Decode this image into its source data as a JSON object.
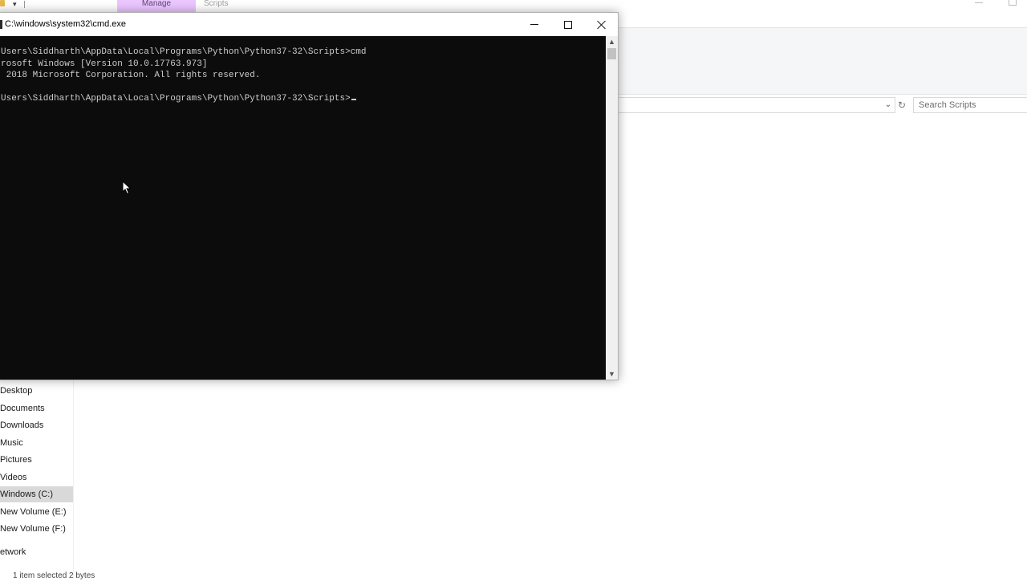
{
  "explorer": {
    "quick_access_dropdown": "▾",
    "manage_tab": "Manage",
    "window_title": "Scripts",
    "search_placeholder": "Search Scripts",
    "address_chevron": "⌄",
    "refresh_icon": "↻",
    "nav_items": [
      {
        "label": "Desktop",
        "icon": "desktop-icon",
        "selected": false
      },
      {
        "label": "Documents",
        "icon": "documents-icon",
        "selected": false
      },
      {
        "label": "Downloads",
        "icon": "downloads-icon",
        "selected": false
      },
      {
        "label": "Music",
        "icon": "music-icon",
        "selected": false
      },
      {
        "label": "Pictures",
        "icon": "pictures-icon",
        "selected": false
      },
      {
        "label": "Videos",
        "icon": "videos-icon",
        "selected": false
      },
      {
        "label": "Windows (C:)",
        "icon": "drive-icon",
        "selected": true
      },
      {
        "label": "New Volume (E:)",
        "icon": "drive-icon",
        "selected": false
      },
      {
        "label": "New Volume (F:)",
        "icon": "drive-icon",
        "selected": false
      },
      {
        "label": "etwork",
        "icon": "network-icon",
        "selected": false
      }
    ],
    "status": "1 item selected  2 bytes"
  },
  "cmd": {
    "title": "C:\\windows\\system32\\cmd.exe",
    "lines": [
      "Users\\Siddharth\\AppData\\Local\\Programs\\Python\\Python37-32\\Scripts>cmd",
      "rosoft Windows [Version 10.0.17763.973]",
      " 2018 Microsoft Corporation. All rights reserved.",
      "",
      "Users\\Siddharth\\AppData\\Local\\Programs\\Python\\Python37-32\\Scripts>"
    ],
    "scroll_up": "▲",
    "scroll_down": "▼"
  },
  "colors": {
    "console_bg": "#0c0c0c",
    "console_text": "#cccccc",
    "manage_tab_bg": "#ebc6ff",
    "selected_nav_bg": "#d9d9d9"
  }
}
